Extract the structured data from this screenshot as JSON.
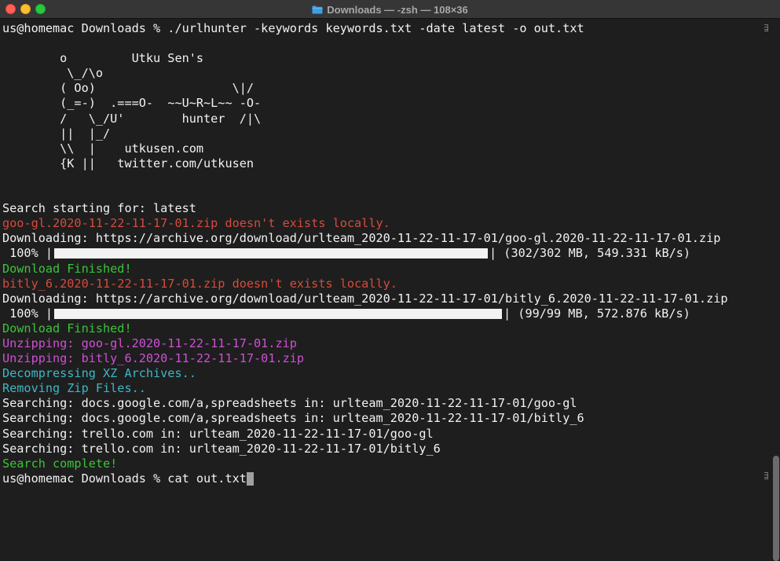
{
  "window": {
    "title": "Downloads — -zsh — 108×36",
    "title_icon": "folder-icon",
    "accent_folder": "#3aa0e8"
  },
  "terminal": {
    "prompt1": "us@homemac Downloads % ./urlhunter -keywords keywords.txt -date latest -o out.txt",
    "art": [
      "        o         Utku Sen's",
      "         \\_/\\o",
      "        ( Oo)                   \\|/",
      "        (_=-)  .===O-  ~~U~R~L~~ -O-",
      "        /   \\_/U'        hunter  /|\\",
      "        ||  |_/",
      "        \\\\  |    utkusen.com",
      "        {K ||   twitter.com/utkusen"
    ],
    "search_start": "Search starting for: latest",
    "missing1": "goo-gl.2020-11-22-11-17-01.zip doesn't exists locally.",
    "downloading1": "Downloading: https://archive.org/download/urlteam_2020-11-22-11-17-01/goo-gl.2020-11-22-11-17-01.zip",
    "progress1": {
      "percent_label": " 100% |",
      "end_label": "| (302/302 MB, 549.331 kB/s)",
      "fraction": 1.0
    },
    "finished1": "Download Finished!",
    "missing2": "bitly_6.2020-11-22-11-17-01.zip doesn't exists locally.",
    "downloading2": "Downloading: https://archive.org/download/urlteam_2020-11-22-11-17-01/bitly_6.2020-11-22-11-17-01.zip",
    "progress2": {
      "percent_label": " 100% |",
      "end_label": "| (99/99 MB, 572.876 kB/s)",
      "fraction": 1.0
    },
    "finished2": "Download Finished!",
    "unzip1": "Unzipping: goo-gl.2020-11-22-11-17-01.zip",
    "unzip2": "Unzipping: bitly_6.2020-11-22-11-17-01.zip",
    "decompress": "Decompressing XZ Archives..",
    "removing": "Removing Zip Files..",
    "search_lines": [
      "Searching: docs.google.com/a,spreadsheets in: urlteam_2020-11-22-11-17-01/goo-gl",
      "Searching: docs.google.com/a,spreadsheets in: urlteam_2020-11-22-11-17-01/bitly_6",
      "Searching: trello.com in: urlteam_2020-11-22-11-17-01/goo-gl",
      "Searching: trello.com in: urlteam_2020-11-22-11-17-01/bitly_6"
    ],
    "search_complete": "Search complete!",
    "prompt2": "us@homemac Downloads % cat out.txt"
  },
  "colors": {
    "background": "#1e1e1e",
    "text": "#f2f2f2",
    "error_red": "#d54b3c",
    "success_green": "#3cc43a",
    "unzip_magenta": "#d04fd6",
    "info_cyan": "#3cb8c5"
  }
}
